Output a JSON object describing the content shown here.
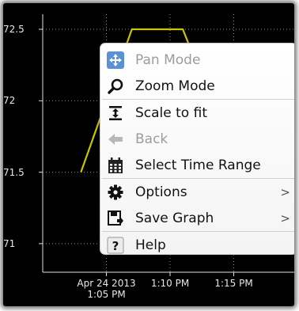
{
  "chart_data": {
    "type": "line",
    "x": [
      "13:03",
      "13:07",
      "13:11",
      "13:15"
    ],
    "y": [
      71.5,
      72.5,
      72.5,
      71.6
    ],
    "ylim": [
      70.8,
      72.55
    ],
    "yticks": [
      "72.5",
      "72",
      "71.5",
      "71"
    ],
    "xticks": [
      "Apr 24 2013\n1:05 PM",
      "1:10 PM",
      "1:15 PM"
    ],
    "grid": true,
    "line_color": "#c9c400"
  },
  "menu": {
    "items": [
      {
        "label": "Pan Mode",
        "icon": "pan-icon",
        "enabled": false
      },
      {
        "label": "Zoom Mode",
        "icon": "zoom-icon",
        "enabled": true
      },
      {
        "label": "Scale to fit",
        "icon": "scale-to-fit-icon",
        "enabled": true
      },
      {
        "label": "Back",
        "icon": "back-icon",
        "enabled": false
      },
      {
        "label": "Select Time Range",
        "icon": "calendar-icon",
        "enabled": true
      },
      {
        "label": "Options",
        "icon": "gear-icon",
        "enabled": true,
        "submenu": ">"
      },
      {
        "label": "Save Graph",
        "icon": "save-icon",
        "enabled": true,
        "submenu": ">"
      },
      {
        "label": "Help",
        "icon": "help-icon",
        "enabled": true
      }
    ]
  }
}
